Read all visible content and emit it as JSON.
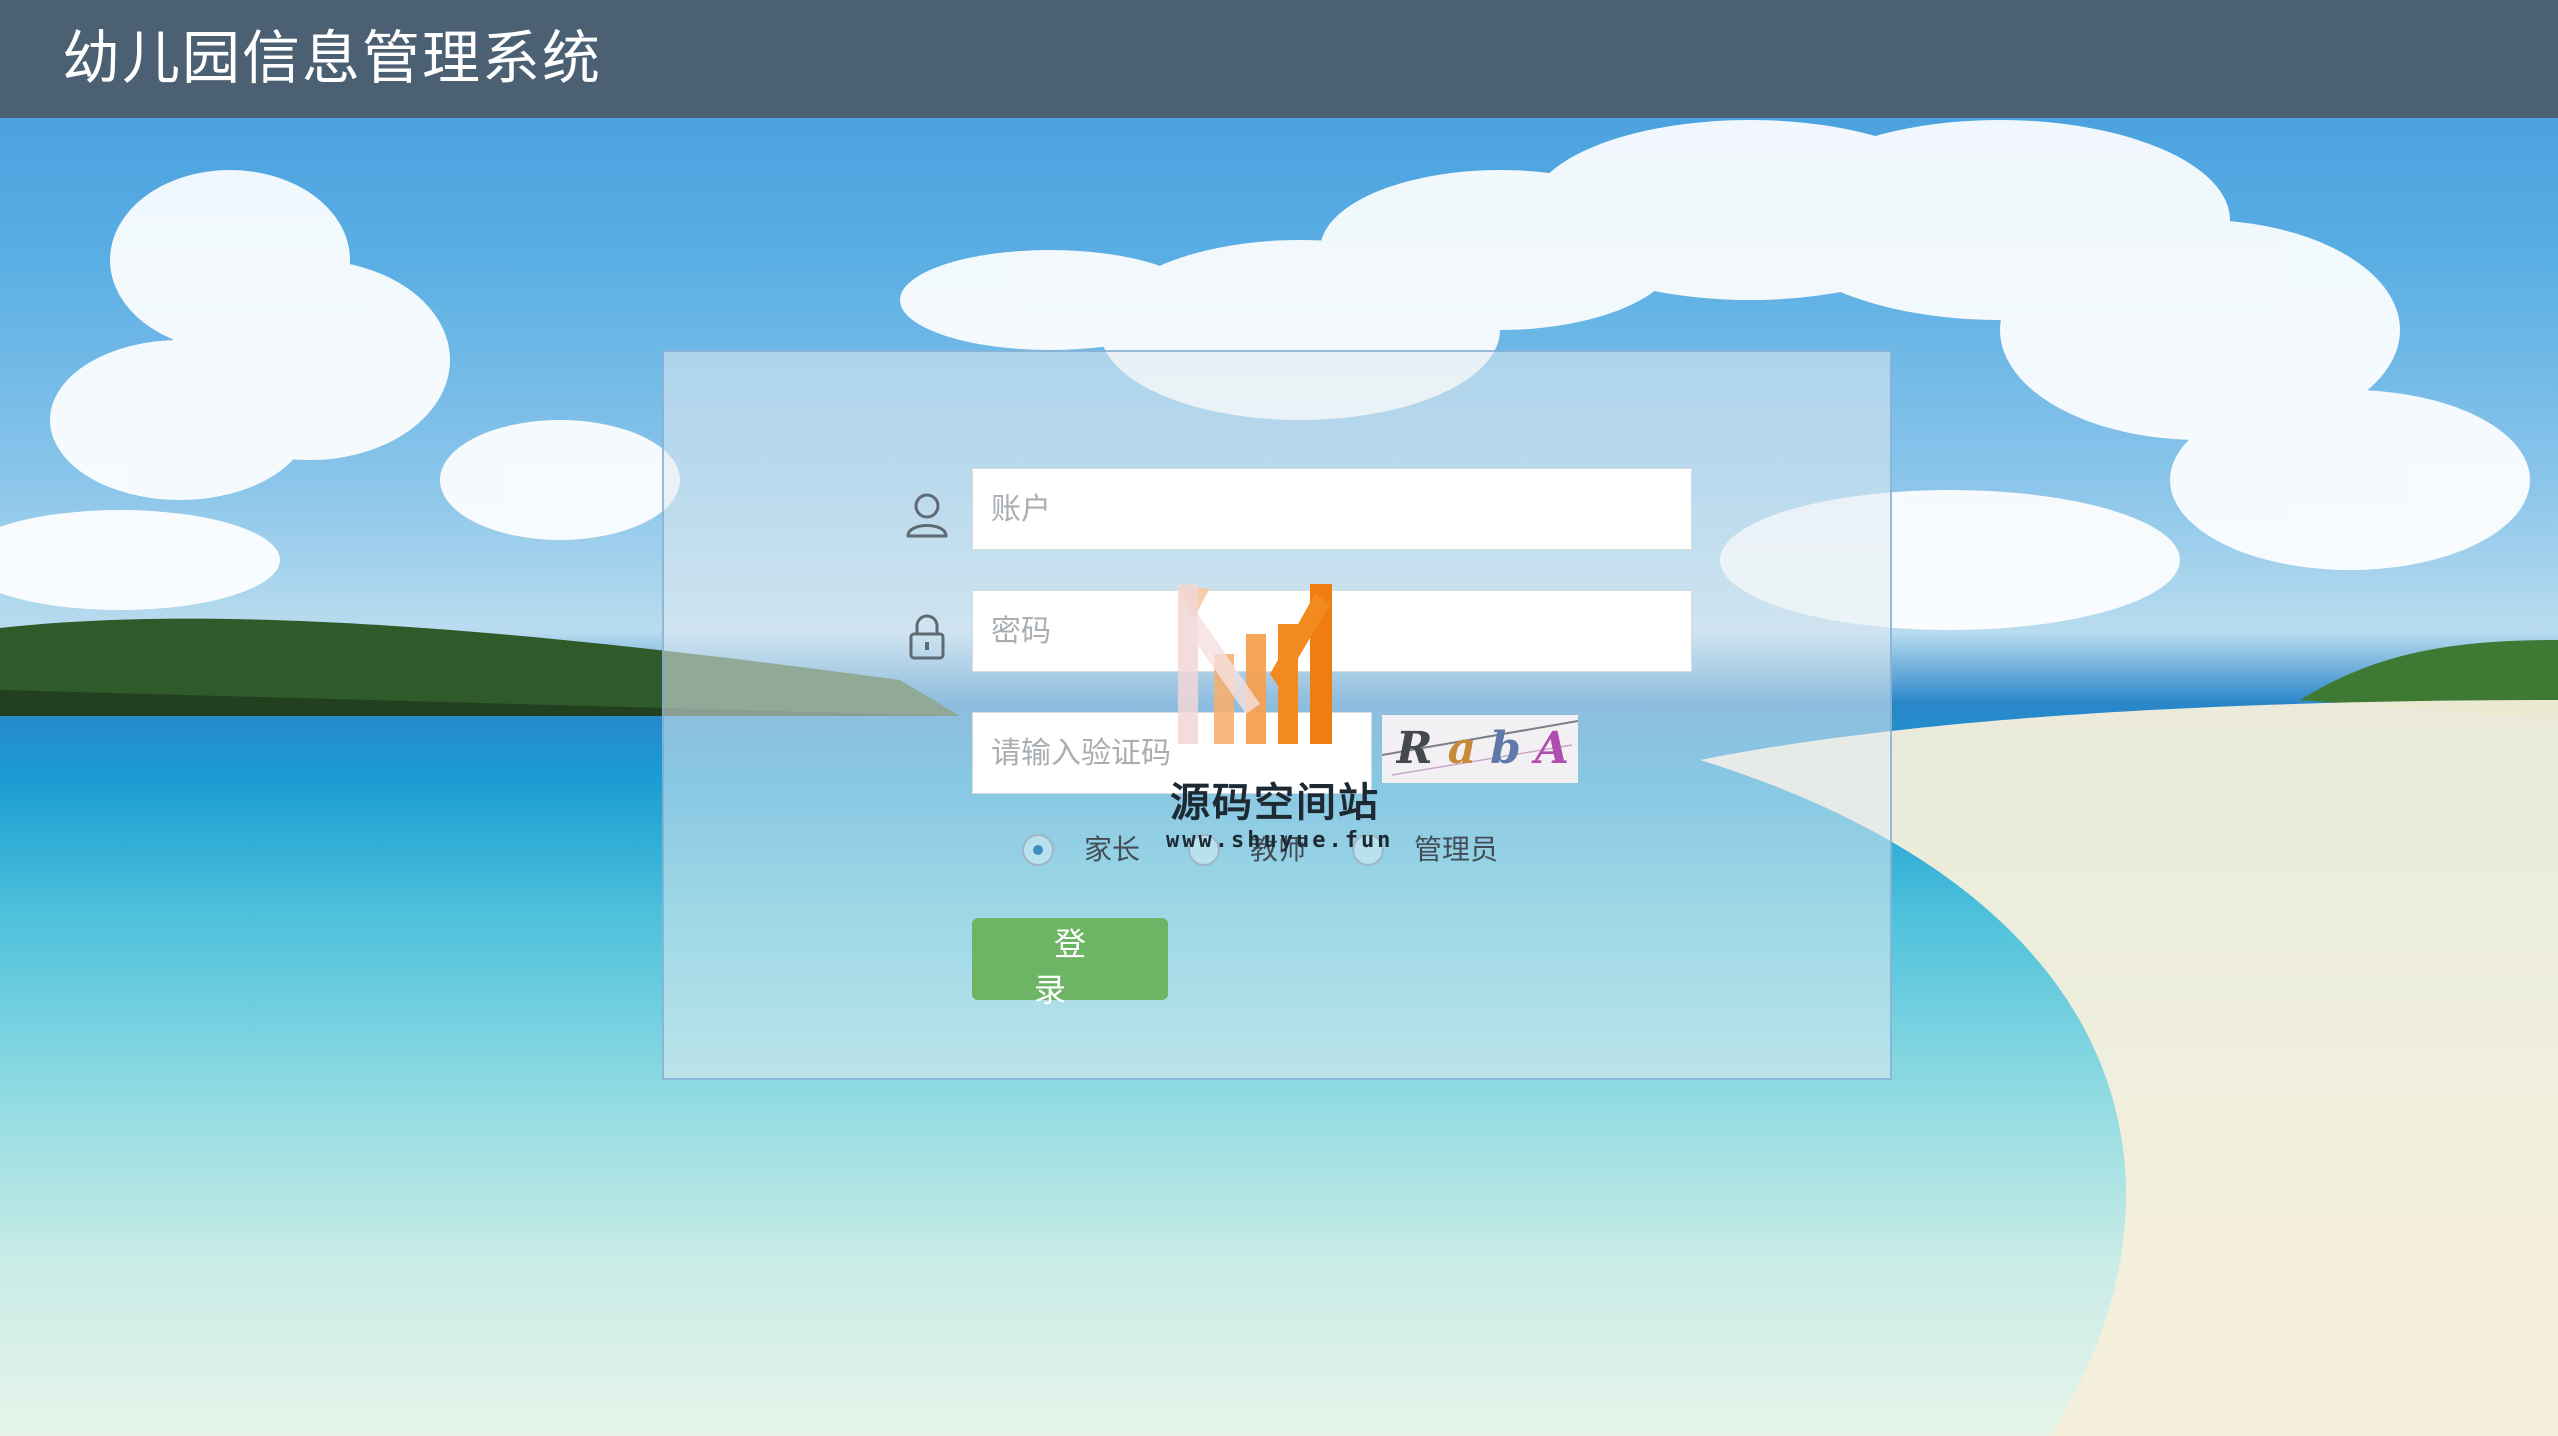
{
  "header": {
    "title": "幼儿园信息管理系统"
  },
  "login": {
    "account": {
      "placeholder": "账户",
      "value": ""
    },
    "password": {
      "placeholder": "密码",
      "value": ""
    },
    "captcha": {
      "placeholder": "请输入验证码",
      "value": "",
      "image_text": "RabA"
    },
    "roles": [
      {
        "label": "家长",
        "checked": true
      },
      {
        "label": "教师",
        "checked": false
      },
      {
        "label": "管理员",
        "checked": false
      }
    ],
    "submit_label": "登 录"
  },
  "watermark": {
    "title": "源码空间站",
    "url": "www.shuyue.fun"
  },
  "icons": {
    "account": "user-icon",
    "password": "lock-icon"
  },
  "colors": {
    "header_bg": "#4b6072",
    "button_bg": "#6db464",
    "radio_checked": "#3f8fc0"
  }
}
